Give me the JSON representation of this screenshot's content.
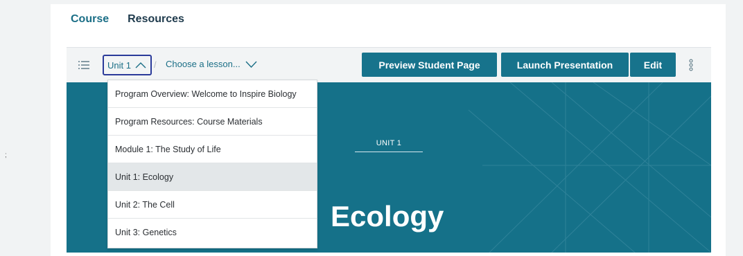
{
  "left_gutter": {
    "marker": ";"
  },
  "course_tabs": [
    {
      "label": "Course",
      "active": true
    },
    {
      "label": "Resources",
      "active": false
    }
  ],
  "toolbar": {
    "menu_icon": "list-icon",
    "unit_selector": {
      "label": "Unit 1",
      "icon": "chevron-up-icon"
    },
    "separator": "/",
    "lesson_selector": {
      "label": "Choose a lesson...",
      "icon": "chevron-down-icon"
    },
    "preview_label": "Preview Student Page",
    "launch_label": "Launch Presentation",
    "edit_label": "Edit",
    "more_icon": "kebab-menu-icon"
  },
  "dropdown": {
    "items": [
      {
        "label": "Program Overview: Welcome to Inspire Biology"
      },
      {
        "label": "Program Resources: Course Materials"
      },
      {
        "label": "Module 1: The Study of Life"
      },
      {
        "label": "Unit 1: Ecology",
        "selected": true
      },
      {
        "label": "Unit 2: The Cell"
      },
      {
        "label": "Unit 3: Genetics"
      }
    ]
  },
  "hero": {
    "unit_label": "UNIT 1",
    "title": "Ecology"
  },
  "colors": {
    "accent": "#17738c",
    "hero_background": "#157189",
    "link": "#1a6e86",
    "focus_border": "#2a3a9a"
  }
}
